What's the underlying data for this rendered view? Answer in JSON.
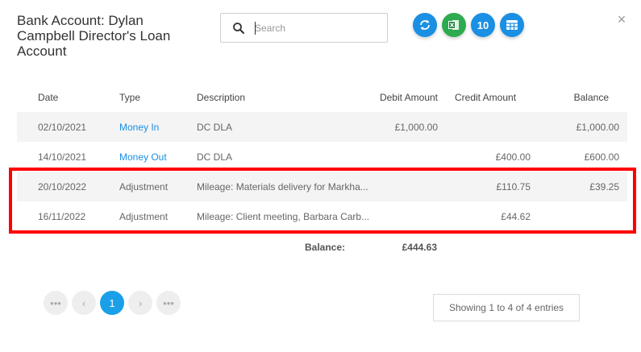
{
  "header": {
    "title": "Bank Account: Dylan Campbell Director's Loan Account"
  },
  "search": {
    "placeholder": "Search",
    "value": ""
  },
  "toolbar": {
    "count_label": "10"
  },
  "colors": {
    "accent": "#1a8fe3",
    "excel": "#2eaa50",
    "highlight": "#ff0000"
  },
  "table": {
    "columns": [
      "Date",
      "Type",
      "Description",
      "Debit Amount",
      "Credit Amount",
      "Balance"
    ],
    "rows": [
      {
        "date": "02/10/2021",
        "type": "Money In",
        "description": "DC DLA",
        "debit": "£1,000.00",
        "credit": "",
        "balance": "£1,000.00"
      },
      {
        "date": "14/10/2021",
        "type": "Money Out",
        "description": "DC DLA",
        "debit": "",
        "credit": "£400.00",
        "balance": "£600.00"
      },
      {
        "date": "20/10/2022",
        "type": "Adjustment",
        "description": "Mileage: Materials delivery for Markha...",
        "debit": "",
        "credit": "£110.75",
        "balance": "£39.25"
      },
      {
        "date": "16/11/2022",
        "type": "Adjustment",
        "description": "Mileage: Client meeting, Barbara Carb...",
        "debit": "",
        "credit": "£44.62",
        "balance": ""
      }
    ]
  },
  "summary": {
    "label": "Balance:",
    "value": "£444.63"
  },
  "pagination": {
    "first": "•••",
    "prev": "‹",
    "current": "1",
    "next": "›",
    "last": "•••",
    "info": "Showing 1 to 4 of 4 entries"
  }
}
